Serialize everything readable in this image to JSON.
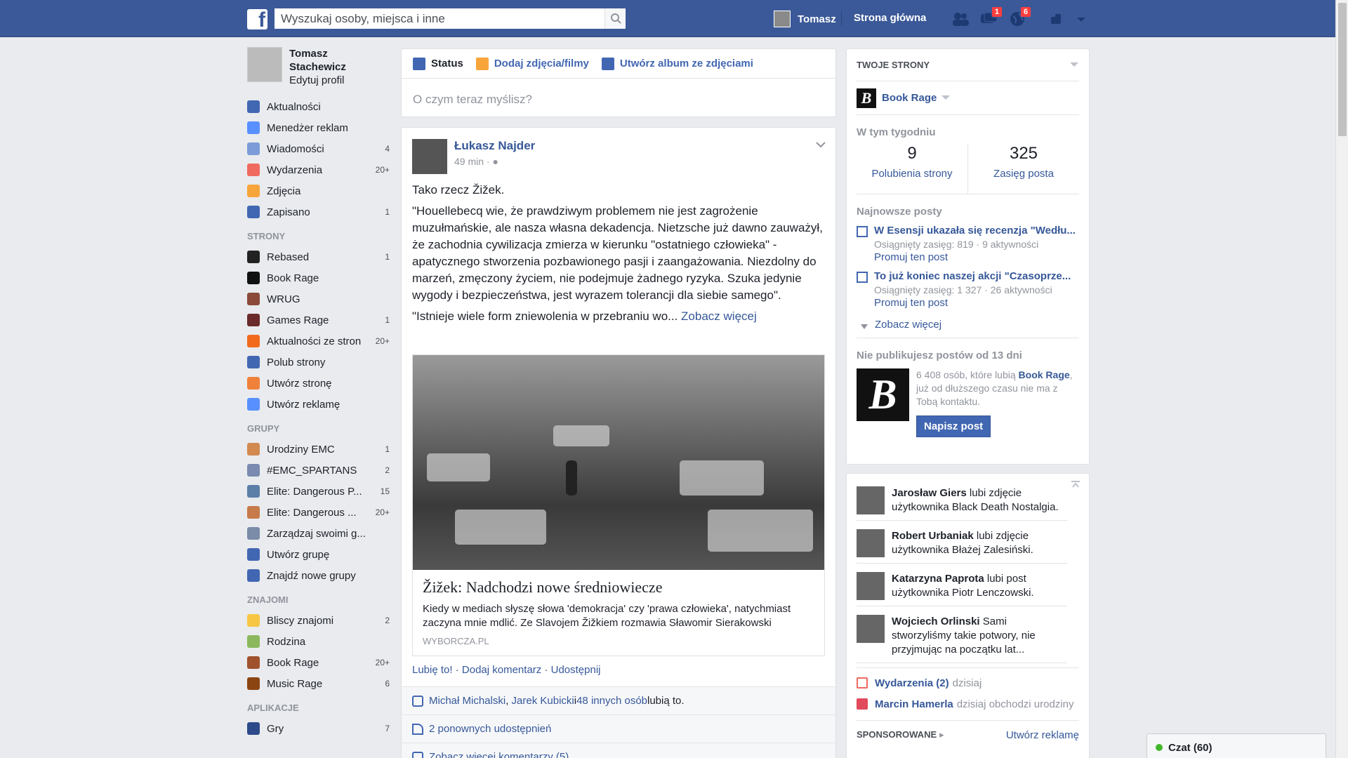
{
  "topbar": {
    "search_placeholder": "Wyszukaj osoby, miejsca i inne",
    "user_name": "Tomasz",
    "home_label": "Strona główna",
    "messages_badge": "1",
    "notifications_badge": "6",
    "color": "#3b5998"
  },
  "profile": {
    "name_line1": "Tomasz",
    "name_line2": "Stachewicz",
    "edit": "Edytuj profil"
  },
  "nav_main": [
    {
      "label": "Aktualności",
      "count": "",
      "color": "#4267b2"
    },
    {
      "label": "Menedżer reklam",
      "count": "",
      "color": "#5890ff"
    },
    {
      "label": "Wiadomości",
      "count": "4",
      "color": "#7b9cd8"
    },
    {
      "label": "Wydarzenia",
      "count": "20+",
      "color": "#f06a5f"
    },
    {
      "label": "Zdjęcia",
      "count": "",
      "color": "#f7a53b"
    },
    {
      "label": "Zapisano",
      "count": "1",
      "color": "#4267b2"
    }
  ],
  "sections": {
    "pages": "STRONY",
    "groups": "GRUPY",
    "friends": "ZNAJOMI",
    "apps": "APLIKACJE"
  },
  "nav_pages": [
    {
      "label": "Rebased",
      "count": "1",
      "color": "#222"
    },
    {
      "label": "Book Rage",
      "count": "",
      "color": "#111"
    },
    {
      "label": "WRUG",
      "count": "",
      "color": "#8b4a3a"
    },
    {
      "label": "Games Rage",
      "count": "1",
      "color": "#6b2a2a"
    },
    {
      "label": "Aktualności ze stron",
      "count": "20+",
      "color": "#f26b1d"
    },
    {
      "label": "Polub strony",
      "count": "",
      "color": "#4267b2"
    },
    {
      "label": "Utwórz stronę",
      "count": "",
      "color": "#f0813a"
    },
    {
      "label": "Utwórz reklamę",
      "count": "",
      "color": "#5890ff"
    }
  ],
  "nav_groups": [
    {
      "label": "Urodziny EMC",
      "count": "1",
      "color": "#d28a50"
    },
    {
      "label": "#EMC_SPARTANS",
      "count": "2",
      "color": "#7a8ab0"
    },
    {
      "label": "Elite: Dangerous P...",
      "count": "15",
      "color": "#5c7fa8"
    },
    {
      "label": "Elite: Dangerous ...",
      "count": "20+",
      "color": "#c77a4a"
    },
    {
      "label": "Zarządzaj swoimi g...",
      "count": "",
      "color": "#7b8ca8"
    },
    {
      "label": "Utwórz grupę",
      "count": "",
      "color": "#4267b2"
    },
    {
      "label": "Znajdź nowe grupy",
      "count": "",
      "color": "#4267b2"
    }
  ],
  "nav_friends": [
    {
      "label": "Bliscy znajomi",
      "count": "2",
      "color": "#f7c744"
    },
    {
      "label": "Rodzina",
      "count": "",
      "color": "#8bb85c"
    },
    {
      "label": "Book Rage",
      "count": "20+",
      "color": "#a0522d"
    },
    {
      "label": "Music Rage",
      "count": "6",
      "color": "#8b4513"
    }
  ],
  "nav_apps": [
    {
      "label": "Gry",
      "count": "7",
      "color": "#2d4b8a"
    }
  ],
  "composer": {
    "tab_status": "Status",
    "tab_photos": "Dodaj zdjęcia/filmy",
    "tab_album": "Utwórz album ze zdjęciami",
    "placeholder": "O czym teraz myślisz?"
  },
  "post": {
    "author": "Łukasz Najder",
    "time": "49 min · ",
    "p1": "Tako rzecz Žižek.",
    "p2": "\"Houellebecq wie, że prawdziwym problemem nie jest zagrożenie muzułmańskie, ale nasza własna dekadencja. Nietzsche już dawno zauważył, że zachodnia cywilizacja zmierza w kierunku \"ostatniego człowieka\" - apatycznego stworzenia pozbawionego pasji i zaangażowania. Niezdolny do marzeń, zmęczony życiem, nie podejmuje żadnego ryzyka. Szuka jedynie wygody i bezpieczeństwa, jest wyrazem tolerancji dla siebie samego\".",
    "p3": "\"Istnieje wiele form zniewolenia w przebraniu wo... ",
    "see_more": "Zobacz więcej",
    "link_title": "Žižek: Nadchodzi nowe średniowiecze",
    "link_desc": "Kiedy w mediach słyszę słowa 'demokracja' czy 'prawa człowieka', natychmiast zaczyna mnie mdlić. Ze Slavojem Žižkiem rozmawia Sławomir Sierakowski",
    "link_source": "WYBORCZA.PL",
    "like": "Lubię to!",
    "comment": "Dodaj komentarz",
    "share": "Udostępnij",
    "likes_n1": "Michał Michalski",
    "likes_n2": "Jarek Kubicki",
    "likes_and": " i ",
    "likes_others": "48 innych osób",
    "likes_tail": " lubią to.",
    "shares": "2 ponownych udostępnień",
    "more_comments": "Zobacz więcej komentarzy (5)"
  },
  "right": {
    "your_pages": "TWOJE STRONY",
    "page_name": "Book Rage",
    "this_week": "W tym tygodniu",
    "stat1_n": "9",
    "stat1_l": "Polubienia strony",
    "stat2_n": "325",
    "stat2_l": "Zasięg posta",
    "recent_posts": "Najnowsze posty",
    "posts": [
      {
        "title": "W Esensji ukazała się recenzja \"Wedłu...",
        "reach": "Osiągnięty zasięg: 819 · 9 aktywności",
        "promote": "Promuj ten post"
      },
      {
        "title": "To już koniec naszej akcji \"Czasoprze...",
        "reach": "Osiągnięty zasięg: 1 327 · 26 aktywności",
        "promote": "Promuj ten post"
      }
    ],
    "see_more": "Zobacz więcej",
    "no_posts": "Nie publikujesz postów od 13 dni",
    "np_text1": "6 408 osób, które lubią ",
    "np_page": "Book Rage",
    "np_text2": ", już od dłuższego czasu nie ma z Tobą kontaktu.",
    "write_post": "Napisz post"
  },
  "ticker": [
    {
      "name": "Jarosław Giers",
      "text": " lubi zdjęcie użytkownika Black Death Nostalgia."
    },
    {
      "name": "Robert Urbaniak",
      "text": " lubi zdjęcie użytkownika Błażej Zalesiński."
    },
    {
      "name": "Katarzyna Paprota",
      "text": " lubi post użytkownika Piotr Lenczowski."
    },
    {
      "name": "Wojciech Orlinski",
      "text": " Sami stworzyliśmy takie potwory, nie przyjmując na początku lat..."
    }
  ],
  "events": {
    "label": "Wydarzenia (2)",
    "when": "dzisiaj",
    "bday_name": "Marcin Hamerla",
    "bday_text": "dzisiaj obchodzi urodziny"
  },
  "sponsored": {
    "label": "SPONSOROWANE",
    "create_ad": "Utwórz reklamę"
  },
  "chat": {
    "label": "Czat (60)"
  }
}
